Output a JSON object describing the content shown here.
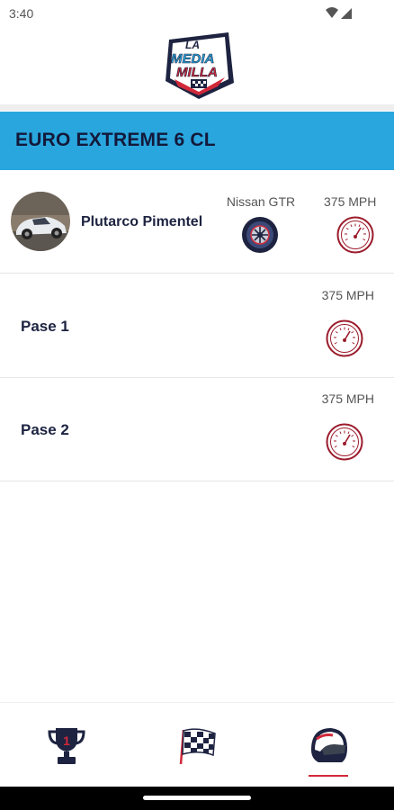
{
  "status_bar": {
    "time": "3:40"
  },
  "header": {
    "logo_text_line1": "LA",
    "logo_text_line2": "MEDIA",
    "logo_text_line3": "MILLA"
  },
  "category": {
    "title": "EURO EXTREME 6 CL"
  },
  "driver": {
    "name": "Plutarco Pimentel",
    "car": "Nissan GTR",
    "top_speed": "375 MPH"
  },
  "passes": [
    {
      "label": "Pase 1",
      "speed": "375 MPH"
    },
    {
      "label": "Pase 2",
      "speed": "375 MPH"
    }
  ],
  "bottom_nav": {
    "items": [
      {
        "icon": "trophy-icon",
        "badge": "1"
      },
      {
        "icon": "checkered-flag-icon"
      },
      {
        "icon": "helmet-icon",
        "active": true
      }
    ]
  },
  "colors": {
    "banner": "#29a6de",
    "accent_red": "#d1293a",
    "navy": "#1d2340"
  }
}
